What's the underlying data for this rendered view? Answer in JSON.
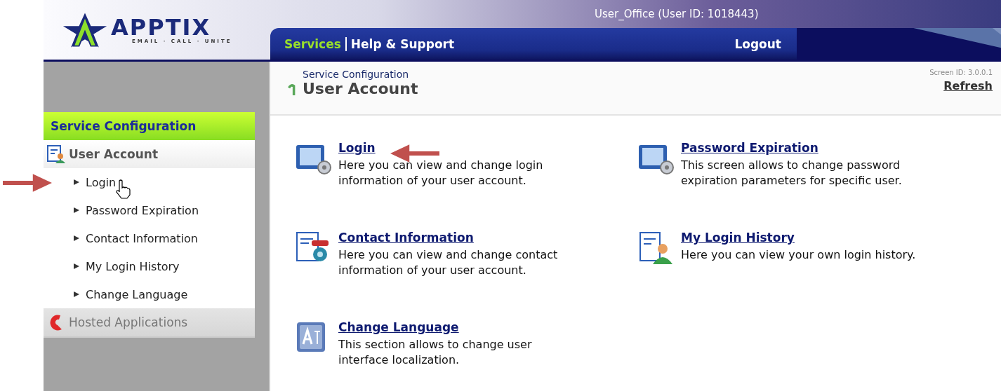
{
  "logo": {
    "name": "APPTIX",
    "tagline": "EMAIL · CALL · UNITE"
  },
  "user_label": "User_Office (User ID: 1018443)",
  "nav_tabs": [
    {
      "label": "Services",
      "selected": true
    },
    {
      "label": "Help & Support",
      "selected": false
    }
  ],
  "logout": "Logout",
  "sidebar": {
    "title": "Service Configuration",
    "groups": [
      {
        "label": "User Account",
        "kind": "account",
        "expanded": true,
        "children": [
          {
            "label": "Login"
          },
          {
            "label": "Password Expiration"
          },
          {
            "label": "Contact Information"
          },
          {
            "label": "My Login History"
          },
          {
            "label": "Change Language"
          }
        ]
      },
      {
        "label": "Hosted Applications",
        "kind": "applications",
        "expanded": false
      }
    ]
  },
  "page_header": {
    "breadcrumb": "Service Configuration",
    "title": "User Account",
    "screen_id": "Screen ID:  3.0.0.1",
    "refresh": "Refresh"
  },
  "options": [
    {
      "kind": "monitor",
      "title": "Login",
      "description": "Here you can view and change login information of your user account."
    },
    {
      "kind": "monitor",
      "title": "Password Expiration",
      "description": "This screen allows to change password expiration parameters for specific user."
    },
    {
      "kind": "contact",
      "title": "Contact Information",
      "description": "Here you can view and change contact information of your user account."
    },
    {
      "kind": "history",
      "title": "My Login History",
      "description": "Here you can view your own login history."
    },
    {
      "kind": "language",
      "title": "Change Language",
      "description": "This section allows to change user interface localization."
    }
  ]
}
